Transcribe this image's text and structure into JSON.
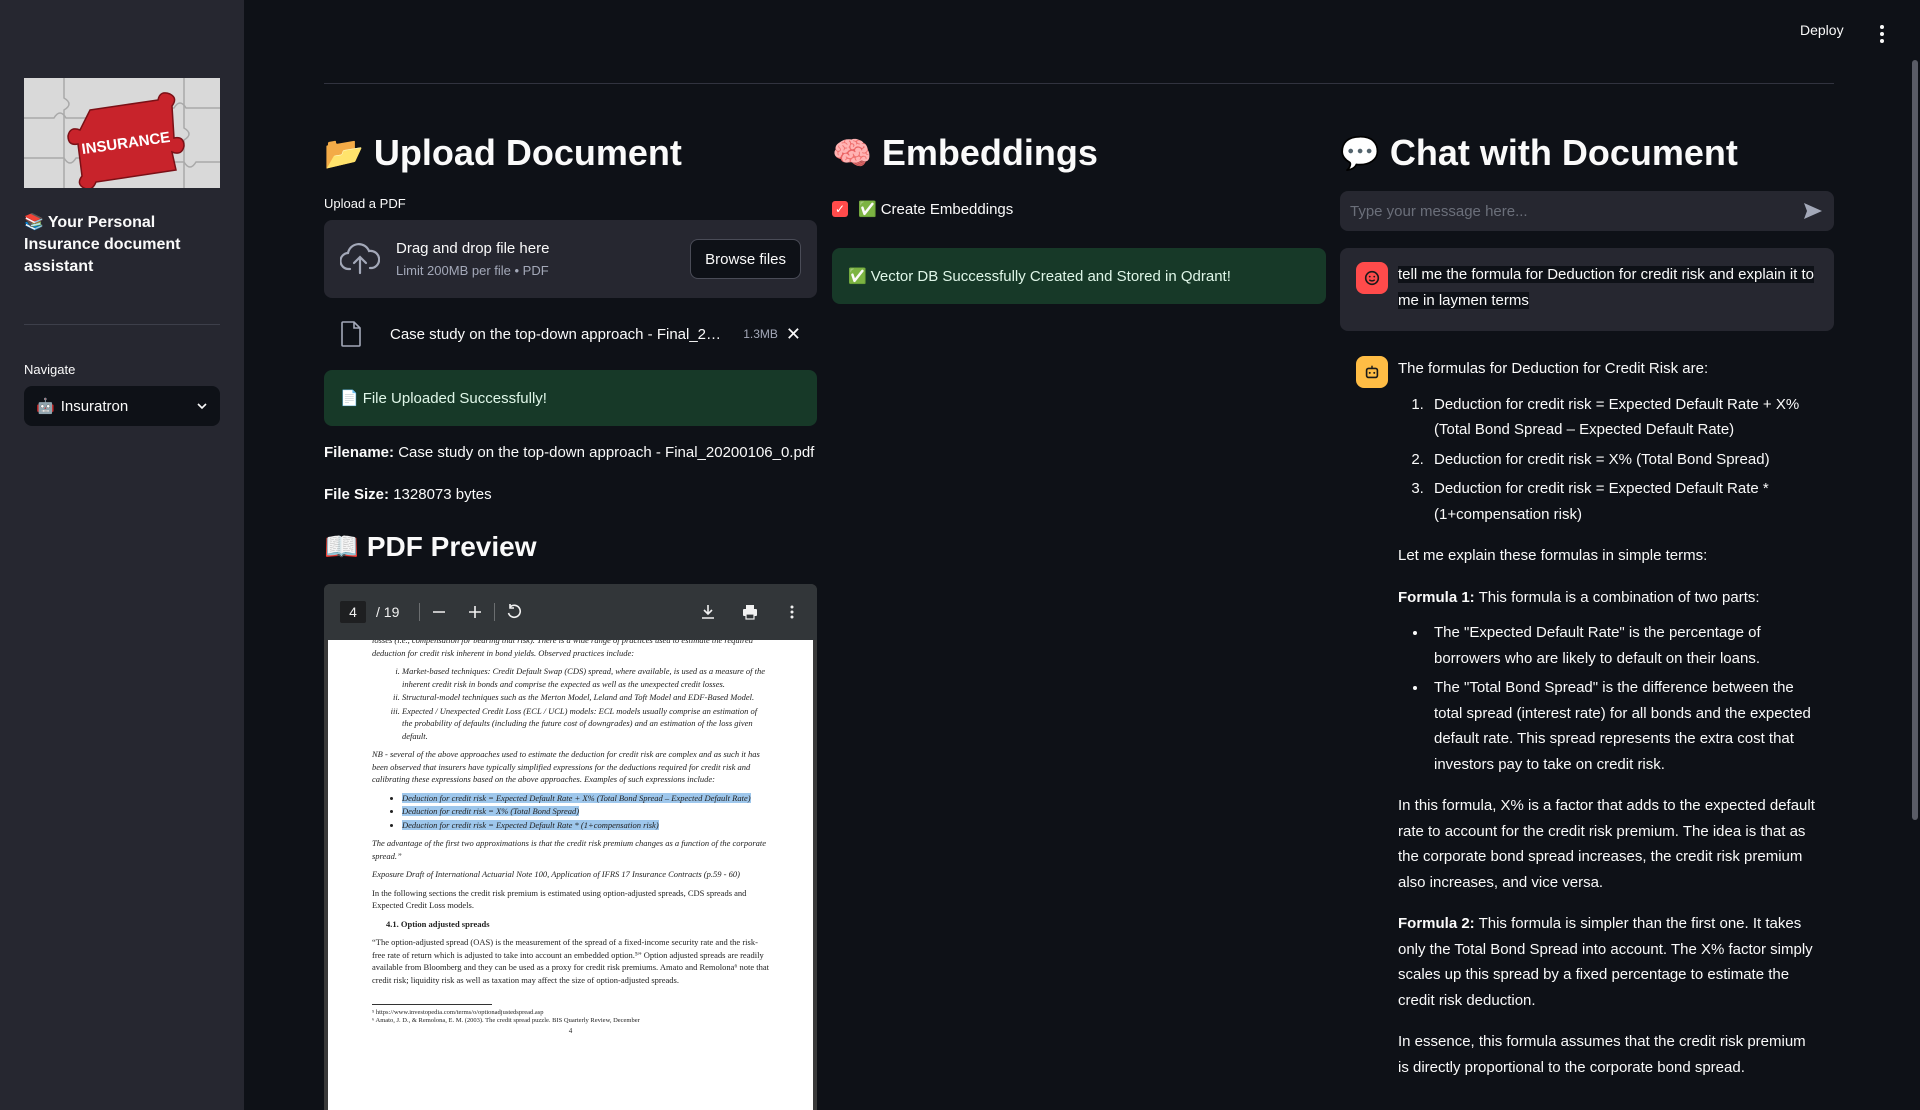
{
  "header": {
    "deploy_label": "Deploy"
  },
  "sidebar": {
    "logo_text": "INSURANCE",
    "title_emoji": "📚",
    "title": "Your Personal Insurance document assistant",
    "nav_label": "Navigate",
    "nav_emoji": "🤖",
    "nav_selected": "Insuratron"
  },
  "upload": {
    "heading_emoji": "📂",
    "heading": "Upload Document",
    "label": "Upload a PDF",
    "drop_title": "Drag and drop file here",
    "drop_sub": "Limit 200MB per file • PDF",
    "browse_label": "Browse files",
    "file_name": "Case study on the top-down approach - Final_20200106_0.pdf",
    "file_size_short": "1.3MB",
    "success_emoji": "📄",
    "success_text": "File Uploaded Successfully!",
    "filename_label": "Filename:",
    "filename_value": "Case study on the top-down approach - Final_20200106_0.pdf",
    "filesize_label": "File Size:",
    "filesize_value": "1328073 bytes"
  },
  "pdf_preview": {
    "heading_emoji": "📖",
    "heading": "PDF Preview",
    "page_current": "4",
    "page_total": "/ 19",
    "page_number": "4",
    "lines": {
      "p0": "losses (i.e., compensation for bearing that risk). There is a wide range of practices used to estimate the required deduction for credit risk inherent in bond yields. Observed practices include:",
      "li1": "Market-based techniques: Credit Default Swap (CDS) spread, where available, is used as a measure of the inherent credit risk in bonds and comprise the expected as well as the unexpected credit losses.",
      "li2": "Structural-model techniques such as the Merton Model, Leland and Toft Model and EDF-Based Model.",
      "li3": "Expected / Unexpected Credit Loss (ECL / UCL) models: ECL models usually comprise an estimation of the probability of defaults (including the future cost of downgrades) and an estimation of the loss given default.",
      "nb": "NB - several of the above approaches used to estimate the deduction for credit risk are complex and as such it has been observed that insurers have typically simplified expressions for the deductions required for credit risk and calibrating these expressions based on the above approaches. Examples of such expressions include:",
      "b1": "Deduction for credit risk = Expected Default Rate + X% (Total Bond Spread – Expected Default Rate)",
      "b2": "Deduction for credit risk = X% (Total Bond Spread)",
      "b3": "Deduction for credit risk = Expected Default Rate * (1+compensation risk)",
      "adv": "The advantage of the first two approximations is that the credit risk premium changes as a function of the corporate spread.”",
      "src": "Exposure Draft of International Actuarial Note 100, Application of IFRS 17 Insurance Contracts (p.59 - 60)",
      "sec": "In the following sections the credit risk premium is estimated using option-adjusted spreads, CDS spreads and Expected Credit Loss models.",
      "h41": "4.1.  Option adjusted spreads",
      "oas": "“The option-adjusted spread (OAS) is the measurement of the spread of a fixed-income security rate and the risk-free rate of return which is adjusted to take into account an embedded option.⁵” Option adjusted spreads are readily available from Bloomberg and they can be used as a proxy for credit risk premiums. Amato and Remolona⁶ note that credit risk; liquidity risk as well as taxation may affect the size of option-adjusted spreads.",
      "fn5": "⁵ https://www.investopedia.com/terms/o/optionadjustedspread.asp",
      "fn6": "⁶ Amato, J. D., & Remolona, E. M. (2003). The credit spread puzzle. BIS Quarterly Review, December"
    }
  },
  "embeddings": {
    "heading_emoji": "🧠",
    "heading": "Embeddings",
    "checkbox_emoji": "✅",
    "checkbox_label": "Create Embeddings",
    "success_emoji": "✅",
    "success_text": "Vector DB Successfully Created and Stored in Qdrant!"
  },
  "chat": {
    "heading_emoji": "💬",
    "heading": "Chat with Document",
    "input_placeholder": "Type your message here...",
    "user_message": "tell me the formula for Deduction for credit risk and explain it to me in laymen terms",
    "bot": {
      "intro": "The formulas for Deduction for Credit Risk are:",
      "formulas": [
        "Deduction for credit risk = Expected Default Rate + X% (Total Bond Spread – Expected Default Rate)",
        "Deduction for credit risk = X% (Total Bond Spread)",
        "Deduction for credit risk = Expected Default Rate * (1+compensation risk)"
      ],
      "explain": "Let me explain these formulas in simple terms:",
      "f1_label": "Formula 1:",
      "f1_text": " This formula is a combination of two parts:",
      "bullets": [
        "The \"Expected Default Rate\" is the percentage of borrowers who are likely to default on their loans.",
        "The \"Total Bond Spread\" is the difference between the total spread (interest rate) for all bonds and the expected default rate. This spread represents the extra cost that investors pay to take on credit risk."
      ],
      "p_f1": "In this formula, X% is a factor that adds to the expected default rate to account for the credit risk premium. The idea is that as the corporate bond spread increases, the credit risk premium also increases, and vice versa.",
      "f2_label": "Formula 2:",
      "f2_text": " This formula is simpler than the first one. It takes only the Total Bond Spread into account. The X% factor simply scales up this spread by a fixed percentage to estimate the credit risk deduction.",
      "p_f2": "In essence, this formula assumes that the credit risk premium is directly proportional to the corporate bond spread."
    }
  },
  "colors": {
    "accent": "#ff4b4b",
    "success_bg": "#173928",
    "sidebar_bg": "#262730",
    "app_bg": "#0e1117"
  }
}
